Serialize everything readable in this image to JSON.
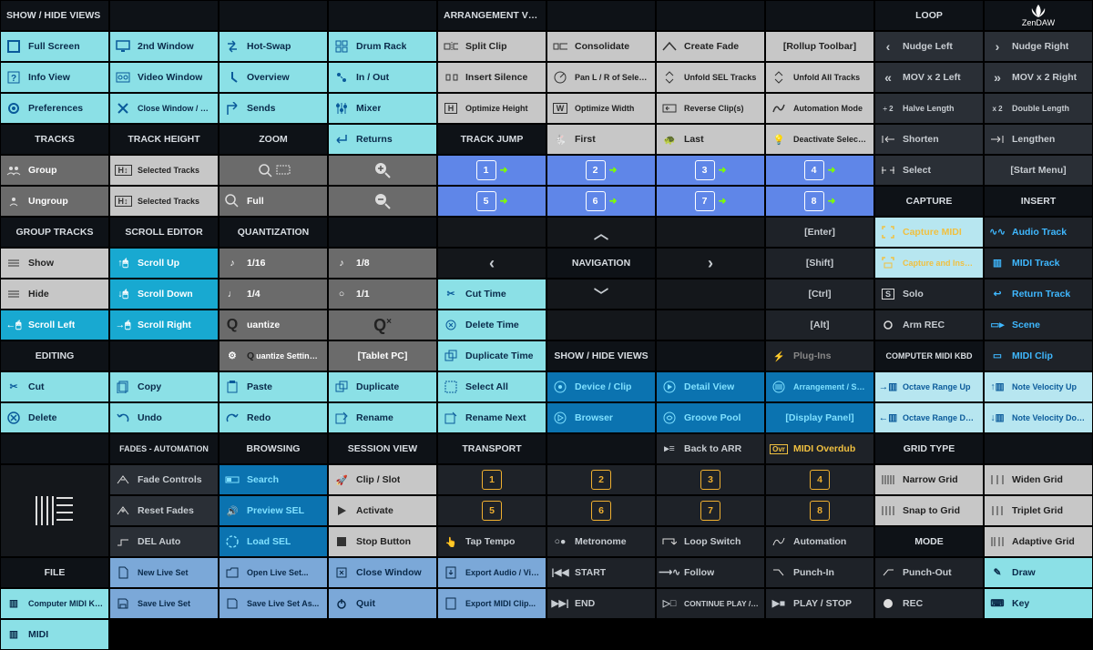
{
  "brand": "ZenDAW",
  "headers": {
    "showHide": "SHOW / HIDE VIEWS",
    "arrangement": "ARRANGEMENT VIEW",
    "loop": "LOOP",
    "tracks": "TRACKS",
    "trackHeight": "TRACK HEIGHT",
    "zoom": "ZOOM",
    "trackJump": "TRACK JUMP",
    "capture": "CAPTURE",
    "insert": "INSERT",
    "groupTracks": "GROUP TRACKS",
    "scrollEditor": "SCROLL EDITOR",
    "quantization": "QUANTIZATION",
    "navigation": "NAVIGATION",
    "editing": "EDITING",
    "computerMidiKbd": "COMPUTER MIDI KBD",
    "showHideViews2": "SHOW / HIDE VIEWS",
    "fadesAuto": "FADES - AUTOMATION",
    "browsing": "BROWSING",
    "sessionView": "SESSION VIEW",
    "transport": "TRANSPORT",
    "gridType": "GRID TYPE",
    "file": "FILE",
    "mode": "MODE"
  },
  "view": {
    "fullScreen": "Full Screen",
    "secondWindow": "2nd Window",
    "hotSwap": "Hot-Swap",
    "drumRack": "Drum Rack",
    "infoView": "Info View",
    "videoWindow": "Video Window",
    "overview": "Overview",
    "inOut": "In / Out",
    "preferences": "Preferences",
    "closeWindow": "Close Window / Dialog",
    "sends": "Sends",
    "mixer": "Mixer",
    "returns": "Returns"
  },
  "arr": {
    "splitClip": "Split Clip",
    "consolidate": "Consolidate",
    "createFade": "Create Fade",
    "rollup": "[Rollup Toolbar]",
    "insertSilence": "Insert Silence",
    "panLR": "Pan L / R of Selection",
    "unfoldSel": "Unfold SEL Tracks",
    "unfoldAll": "Unfold All Tracks",
    "optH": "Optimize Height",
    "optW": "Optimize Width",
    "reverse": "Reverse Clip(s)",
    "autoMode": "Automation Mode",
    "first": "First",
    "last": "Last",
    "deactivate": "Deactivate Selection"
  },
  "loop": {
    "nudgeLeft": "Nudge Left",
    "nudgeRight": "Nudge Right",
    "movLeft": "MOV x 2 Left",
    "movRight": "MOV x 2 Right",
    "halve": "Halve Length",
    "double": "Double Length",
    "shorten": "Shorten",
    "lengthen": "Lengthen",
    "select": "Select",
    "startMenu": "[Start Menu]"
  },
  "tracks": {
    "group": "Group",
    "ungroup": "Ungroup",
    "selTracks": "Selected Tracks",
    "full": "Full"
  },
  "group": {
    "show": "Show",
    "hide": "Hide",
    "scrollLeft": "Scroll Left",
    "scrollUp": "Scroll Up",
    "scrollDown": "Scroll Down",
    "scrollRight": "Scroll Right"
  },
  "quant": {
    "q16": "1/16",
    "q8": "1/8",
    "q4": "1/4",
    "q1": "1/1",
    "quantize": "uantize",
    "qSettings": "uantize Settings..."
  },
  "mod": {
    "enter": "[Enter]",
    "shift": "[Shift]",
    "ctrl": "[Ctrl]",
    "alt": "[Alt]",
    "tablet": "[Tablet PC]",
    "plugins": "Plug-Ins",
    "display": "[Display Panel]"
  },
  "cap": {
    "captureMidi": "Capture MIDI",
    "captureInsert": "Capture and Insert Scene",
    "solo": "Solo",
    "armRec": "Arm REC"
  },
  "ins": {
    "audio": "Audio Track",
    "midi": "MIDI Track",
    "return": "Return Track",
    "scene": "Scene",
    "midiClip": "MIDI Clip"
  },
  "time": {
    "cut": "Cut Time",
    "delete": "Delete Time",
    "duplicate": "Duplicate Time"
  },
  "edit": {
    "cut": "Cut",
    "copy": "Copy",
    "paste": "Paste",
    "duplicate": "Duplicate",
    "selectAll": "Select All",
    "delete": "Delete",
    "undo": "Undo",
    "redo": "Redo",
    "rename": "Rename",
    "renameNext": "Rename Next"
  },
  "shv": {
    "device": "Device / Clip",
    "detail": "Detail View",
    "arrSession": "Arrangement / Session",
    "browser": "Browser",
    "groove": "Groove Pool"
  },
  "kbd": {
    "octUp": "Octave Range Up",
    "octDown": "Octave Range Down",
    "velUp": "Note Velocity Up",
    "velDown": "Note Velocity Down"
  },
  "fades": {
    "controls": "Fade Controls",
    "reset": "Reset Fades",
    "delAuto": "DEL Auto"
  },
  "browse": {
    "search": "Search",
    "preview": "Preview SEL",
    "load": "Load SEL",
    "close": "Close Window"
  },
  "session": {
    "clipSlot": "Clip / Slot",
    "activate": "Activate",
    "stop": "Stop Button",
    "exportAV": "Export Audio / Video",
    "exportMidi": "Export MIDI Clip..."
  },
  "transport": {
    "backArr": "Back to ARR",
    "midiOverdub": "MIDI Overdub",
    "tap": "Tap Tempo",
    "metro": "Metronome",
    "loopSwitch": "Loop Switch",
    "automation": "Automation",
    "start": "START",
    "follow": "Follow",
    "punchIn": "Punch-In",
    "punchOut": "Punch-Out",
    "end": "END",
    "continue": "CONTINUE PLAY / STOP",
    "playStop": "PLAY / STOP",
    "rec": "REC"
  },
  "gridT": {
    "narrow": "Narrow Grid",
    "widen": "Widen Grid",
    "snap": "Snap to Grid",
    "triplet": "Triplet Grid",
    "adaptive": "Adaptive Grid"
  },
  "modeS": {
    "draw": "Draw",
    "compKbd": "Computer MIDI Keyboard",
    "key": "Key",
    "midi": "MIDI"
  },
  "file": {
    "new": "New Live Set",
    "open": "Open Live Set...",
    "save": "Save Live Set",
    "saveAs": "Save Live Set As...",
    "quit": "Quit"
  },
  "nums": {
    "n1": "1",
    "n2": "2",
    "n3": "3",
    "n4": "4",
    "n5": "5",
    "n6": "6",
    "n7": "7",
    "n8": "8"
  },
  "glyph": {
    "H": "H",
    "W": "W",
    "S": "S",
    "Q": "Q",
    "Ovr": "Ovr",
    "x2L": "÷ 2",
    "x2R": "x 2"
  }
}
